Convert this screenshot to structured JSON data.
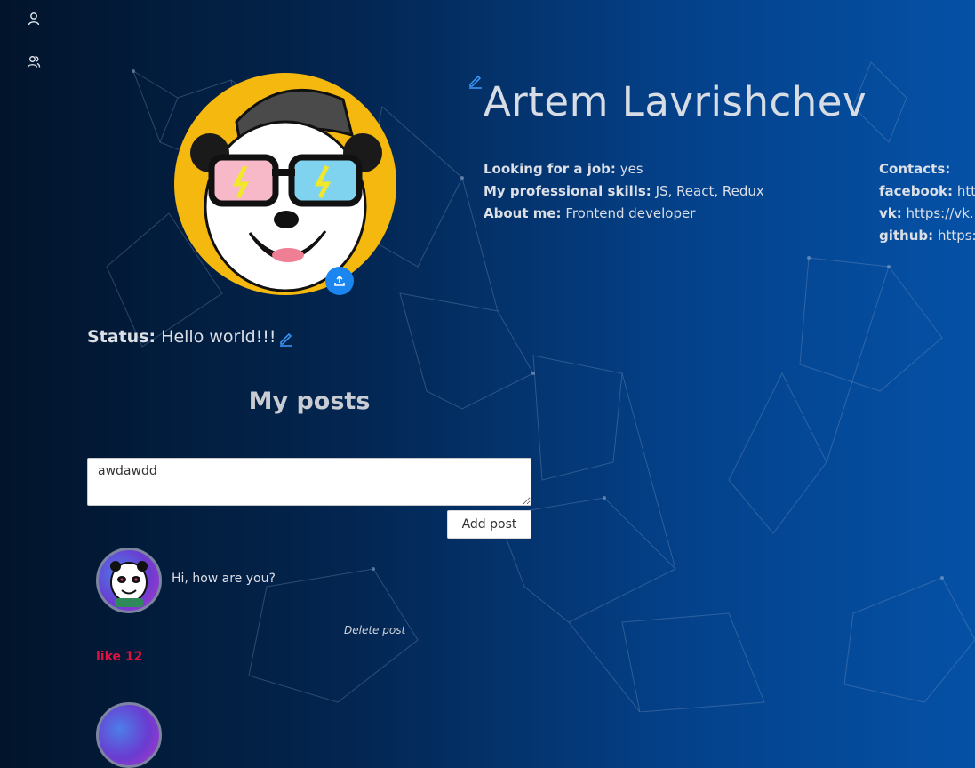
{
  "profile": {
    "name": "Artem Lavrishchev",
    "looking_for_job_label": "Looking for a job:",
    "looking_for_job_value": "yes",
    "skills_label": "My professional skills:",
    "skills_value": "JS, React, Redux",
    "about_label": "About me:",
    "about_value": "Frontend developer"
  },
  "contacts": {
    "title": "Contacts:",
    "items": [
      {
        "label": "facebook:",
        "value": "htt"
      },
      {
        "label": "vk:",
        "value": "https://vk."
      },
      {
        "label": "github:",
        "value": "https:"
      }
    ]
  },
  "status": {
    "label": "Status:",
    "value": "Hello world!!!"
  },
  "posts": {
    "title": "My posts",
    "input_value": "awdawdd",
    "add_button": "Add post",
    "items": [
      {
        "text": "Hi, how are you?",
        "delete_label": "Delete post",
        "like_label": "like 12"
      }
    ]
  },
  "icons": {
    "sidebar": [
      "user-icon",
      "users-icon"
    ],
    "edit": "pencil-icon",
    "upload": "upload-icon"
  },
  "colors": {
    "accent": "#1b86f0",
    "like": "#e0103f",
    "avatar_bg": "#f5b80f"
  }
}
